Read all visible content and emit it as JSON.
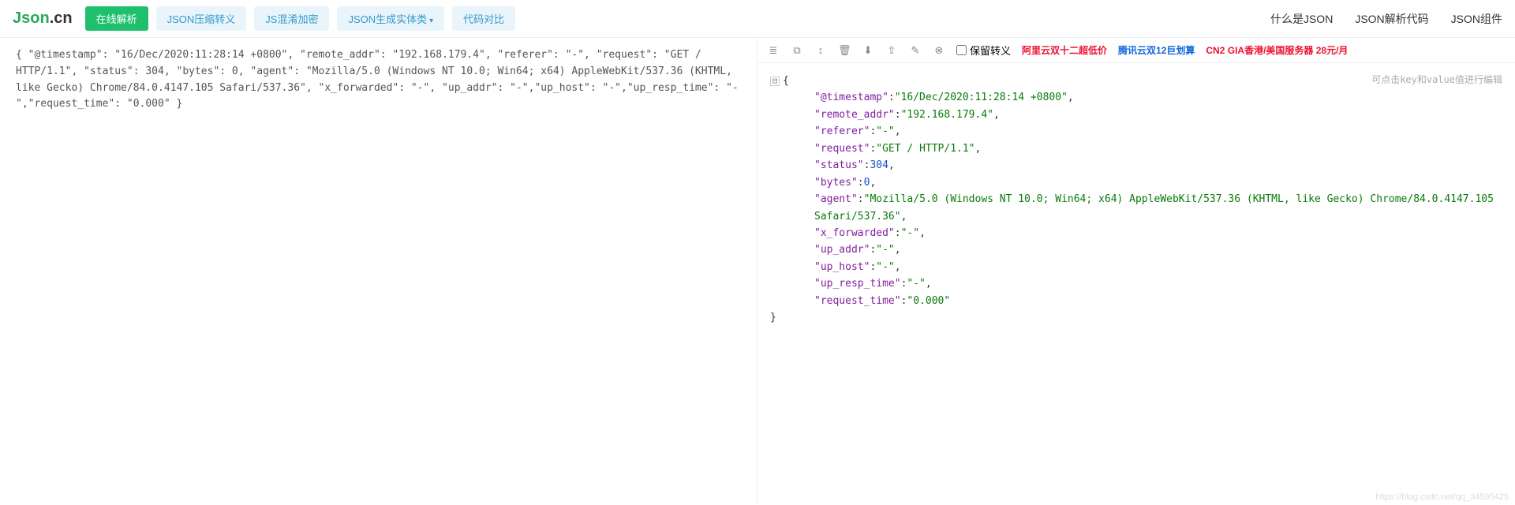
{
  "logo": {
    "json": "Json",
    "dot": ".",
    "cn": "cn"
  },
  "nav_buttons": {
    "parse": "在线解析",
    "compress": "JSON压缩转义",
    "obfuscate": "JS混淆加密",
    "entity": "JSON生成实体类",
    "diff": "代码对比"
  },
  "nav_right": {
    "what": "什么是JSON",
    "parse_code": "JSON解析代码",
    "component": "JSON组件"
  },
  "raw_input": "{ \"@timestamp\": \"16/Dec/2020:11:28:14 +0800\", \"remote_addr\": \"192.168.179.4\", \"referer\": \"-\", \"request\": \"GET / HTTP/1.1\", \"status\": 304, \"bytes\": 0, \"agent\": \"Mozilla/5.0 (Windows NT 10.0; Win64; x64) AppleWebKit/537.36 (KHTML, like Gecko) Chrome/84.0.4147.105 Safari/537.36\", \"x_forwarded\": \"-\", \"up_addr\": \"-\",\"up_host\": \"-\",\"up_resp_time\": \"-\",\"request_time\": \"0.000\" }",
  "toolbar": {
    "keep_escape": "保留转义",
    "promo1": "阿里云双十二超低价",
    "promo2": "腾讯云双12巨划算",
    "promo3": "CN2 GIA香港/美国服务器 28元/月"
  },
  "hint": "可点击key和value值进行编辑",
  "json_fields": [
    {
      "key": "@timestamp",
      "type": "str",
      "value": "16/Dec/2020:11:28:14  +0800"
    },
    {
      "key": "remote_addr",
      "type": "str",
      "value": "192.168.179.4"
    },
    {
      "key": "referer",
      "type": "str",
      "value": "-"
    },
    {
      "key": "request",
      "type": "str",
      "value": "GET  /  HTTP/1.1"
    },
    {
      "key": "status",
      "type": "num",
      "value": "304"
    },
    {
      "key": "bytes",
      "type": "num",
      "value": "0"
    },
    {
      "key": "agent",
      "type": "str",
      "value": "Mozilla/5.0  (Windows  NT  10.0;  Win64;  x64)  AppleWebKit/537.36  (KHTML,  like Gecko) Chrome/84.0.4147.105  Safari/537.36"
    },
    {
      "key": "x_forwarded",
      "type": "str",
      "value": "-"
    },
    {
      "key": "up_addr",
      "type": "str",
      "value": "-"
    },
    {
      "key": "up_host",
      "type": "str",
      "value": "-"
    },
    {
      "key": "up_resp_time",
      "type": "str",
      "value": "-"
    },
    {
      "key": "request_time",
      "type": "str",
      "value": "0.000"
    }
  ],
  "watermark": "https://blog.csdn.net/qq_34595425"
}
